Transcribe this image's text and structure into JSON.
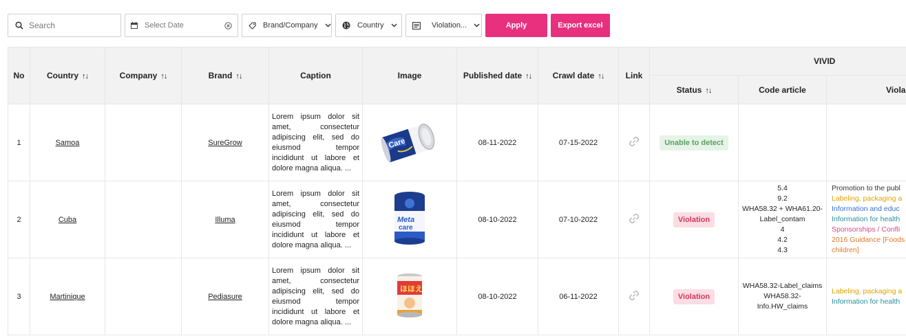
{
  "toolbar": {
    "search_placeholder": "Search",
    "date_placeholder": "Select Date",
    "brand_label": "Brand/Company",
    "country_label": "Country",
    "violation_label": "Violation...",
    "apply_label": "Apply",
    "export_label": "Export excel",
    "accent_color": "#e8307f"
  },
  "table": {
    "headers": {
      "no": "No",
      "country": "Country",
      "company": "Company",
      "brand": "Brand",
      "caption": "Caption",
      "image": "Image",
      "published": "Published date",
      "crawl": "Crawl date",
      "link": "Link",
      "group": "VIVID",
      "status": "Status",
      "code": "Code article",
      "violation": "Viola"
    },
    "sort_glyph": "↑↓",
    "rows": [
      {
        "no": "1",
        "country": "Samoa",
        "company": "",
        "brand": "SureGrow",
        "caption": "Lorem ipsum dolor sit amet, consectetur adipiscing elit, sed do eiusmod tempor incididunt ut labore et dolore magna aliqua. ...",
        "published": "08-11-2022",
        "crawl": "07-15-2022",
        "status": "Unable to detect",
        "codes": [],
        "violations": []
      },
      {
        "no": "2",
        "country": "Cuba",
        "company": "",
        "brand": "Illuma",
        "caption": "Lorem ipsum dolor sit amet, consectetur adipiscing elit, sed do eiusmod tempor incididunt ut labore et dolore magna aliqua. ...",
        "published": "08-10-2022",
        "crawl": "07-10-2022",
        "status": "Violation",
        "codes": [
          "5.4",
          "9.2",
          "WHA58.32 + WHA61.20-Label_contam",
          "4",
          "4.2",
          "4.3"
        ],
        "violations": [
          {
            "text": "Promotion to the publ",
            "color": "#333333"
          },
          {
            "text": "Labeling, packaging a",
            "color": "#e0a100"
          },
          {
            "text": "Information and educ",
            "color": "#3a6fd0"
          },
          {
            "text": "Information for health",
            "color": "#2a8f9e"
          },
          {
            "text": "Sponsorships / Confli",
            "color": "#d04a8a"
          },
          {
            "text": "2016 Guidance [Foods",
            "color": "#e0782a"
          },
          {
            "text": "children]",
            "color": "#e0782a"
          }
        ]
      },
      {
        "no": "3",
        "country": "Martinique",
        "company": "",
        "brand": "Pediasure",
        "caption": "Lorem ipsum dolor sit amet, consectetur adipiscing elit, sed do eiusmod tempor incididunt ut labore et dolore magna aliqua. ...",
        "published": "08-10-2022",
        "crawl": "06-11-2022",
        "status": "Violation",
        "codes": [
          "WHA58.32-Label_claims",
          "WHA58.32-",
          "Info.HW_claims"
        ],
        "violations": [
          {
            "text": "Labeling, packaging a",
            "color": "#e0a100"
          },
          {
            "text": "Information for health",
            "color": "#2a8f9e"
          }
        ]
      }
    ]
  }
}
